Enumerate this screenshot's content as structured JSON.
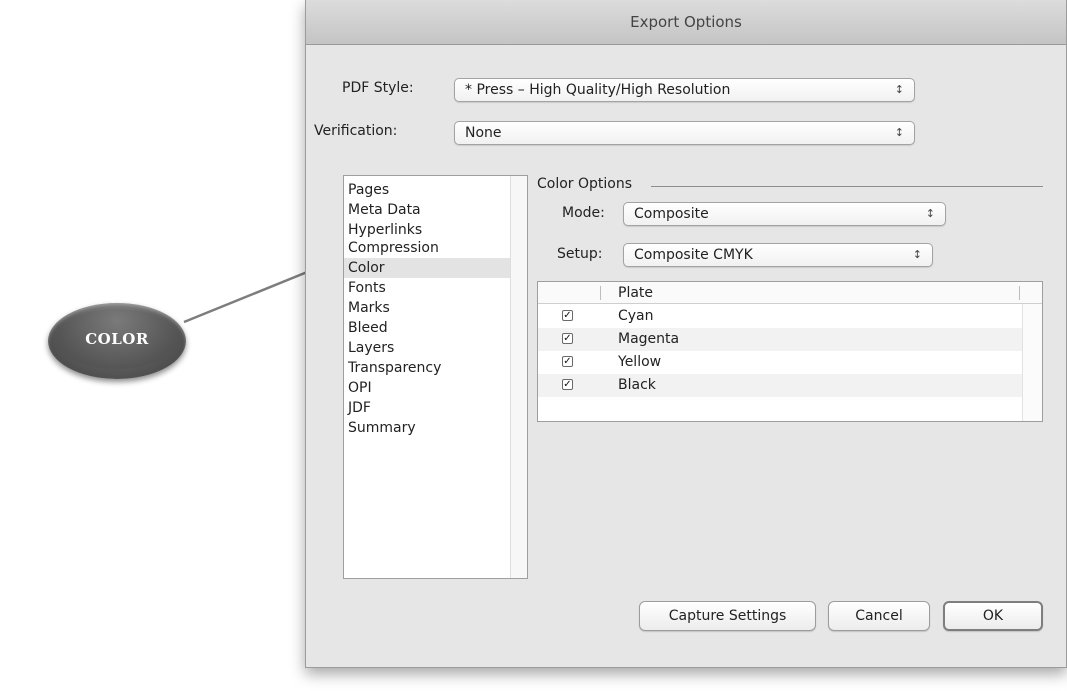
{
  "callout": {
    "label": "COLOR"
  },
  "dialog": {
    "title": "Export Options",
    "pdf_style": {
      "label": "PDF Style:",
      "value": "* Press – High Quality/High Resolution"
    },
    "verification": {
      "label": "Verification:",
      "value": "None"
    },
    "categories": [
      {
        "label": "Pages"
      },
      {
        "label": "Meta Data"
      },
      {
        "label": "Hyperlinks"
      },
      {
        "label": "Compression"
      },
      {
        "label": "Color",
        "selected": true
      },
      {
        "label": "Fonts"
      },
      {
        "label": "Marks"
      },
      {
        "label": "Bleed"
      },
      {
        "label": "Layers"
      },
      {
        "label": "Transparency"
      },
      {
        "label": "OPI"
      },
      {
        "label": "JDF"
      },
      {
        "label": "Summary"
      }
    ],
    "color_options": {
      "title": "Color Options",
      "mode": {
        "label": "Mode:",
        "value": "Composite"
      },
      "setup": {
        "label": "Setup:",
        "value": "Composite CMYK"
      },
      "plate_header": "Plate",
      "plates": [
        {
          "name": "Cyan",
          "checked": true
        },
        {
          "name": "Magenta",
          "checked": true
        },
        {
          "name": "Yellow",
          "checked": true
        },
        {
          "name": "Black",
          "checked": true
        }
      ]
    },
    "buttons": {
      "capture": "Capture Settings",
      "cancel": "Cancel",
      "ok": "OK"
    },
    "stepper_glyph": "↕"
  }
}
